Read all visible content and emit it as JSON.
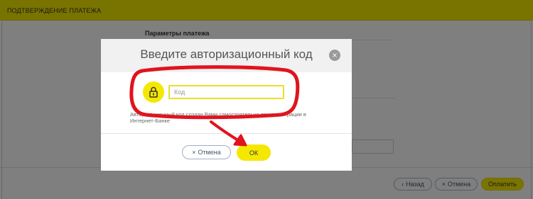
{
  "page": {
    "header_title": "ПОДТВЕРЖДЕНИЕ ПЛАТЕЖА",
    "section_title": "Параметры платежа",
    "footer": {
      "back_label": "Назад",
      "back_icon": "chevron-left-icon",
      "cancel_label": "Отмена",
      "cancel_icon": "close-icon",
      "pay_label": "Оплатить"
    }
  },
  "modal": {
    "title": "Введите авторизационный код",
    "close_icon": "close-icon",
    "lock_icon": "lock-icon",
    "input": {
      "value": "",
      "placeholder": "Код"
    },
    "hint": "Авторизационный код создан Вами самостоятельно при регистрации в Интернет-Банке",
    "cancel_label": "Отмена",
    "ok_label": "ОК"
  },
  "colors": {
    "accent_yellow": "#f5e800",
    "annotation_red": "#e0141e",
    "overlay": "rgba(0,0,0,0.5)"
  }
}
